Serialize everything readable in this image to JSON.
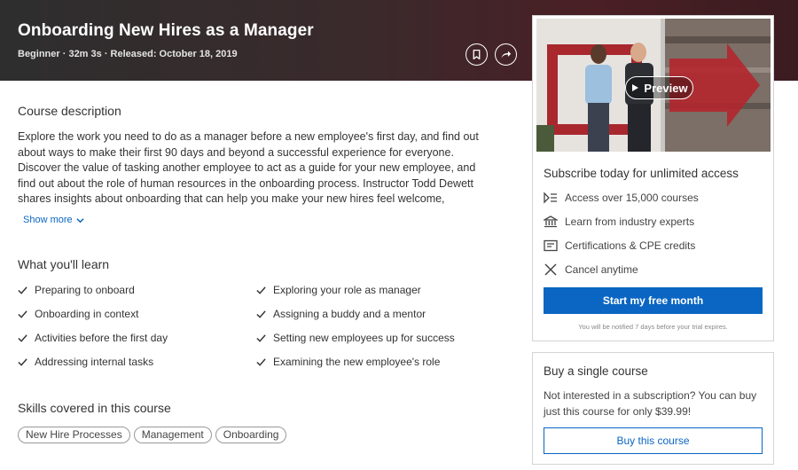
{
  "course": {
    "title": "Onboarding New Hires as a Manager",
    "meta": "Beginner · 32m 3s · Released: October 18, 2019"
  },
  "description": {
    "heading": "Course description",
    "text": "Explore the work you need to do as a manager before a new employee's first day, and find out about ways to make their first 90 days and beyond a successful experience for everyone. Discover the value of tasking another employee to act as a guide for your new employee, and find out about the role of human resources in the onboarding process. Instructor Todd Dewett shares insights about onboarding that can help you make your new hires feel welcome, informed, and",
    "show_more": "Show more"
  },
  "learn": {
    "heading": "What you'll learn",
    "items": [
      "Preparing to onboard",
      "Exploring your role as manager",
      "Onboarding in context",
      "Assigning a buddy and a mentor",
      "Activities before the first day",
      "Setting new employees up for success",
      "Addressing internal tasks",
      "Examining the new employee's role"
    ]
  },
  "skills": {
    "heading": "Skills covered in this course",
    "items": [
      "New Hire Processes",
      "Management",
      "Onboarding"
    ]
  },
  "subscribe": {
    "preview_label": "Preview",
    "title": "Subscribe today for unlimited access",
    "features": [
      {
        "icon": "courses-icon",
        "label": "Access over 15,000 courses"
      },
      {
        "icon": "institution-icon",
        "label": "Learn from industry experts"
      },
      {
        "icon": "certificate-icon",
        "label": "Certifications & CPE credits"
      },
      {
        "icon": "close-icon",
        "label": "Cancel anytime"
      }
    ],
    "cta": "Start my free month",
    "note": "You will be notified 7 days before your trial expires."
  },
  "buy": {
    "title": "Buy a single course",
    "text": "Not interested in a subscription? You can buy just this course for only $39.99!",
    "cta": "Buy this course"
  },
  "colors": {
    "accent": "#0a66c2",
    "hero_left": "#2e2e2e",
    "hero_right": "#4a1f25"
  }
}
